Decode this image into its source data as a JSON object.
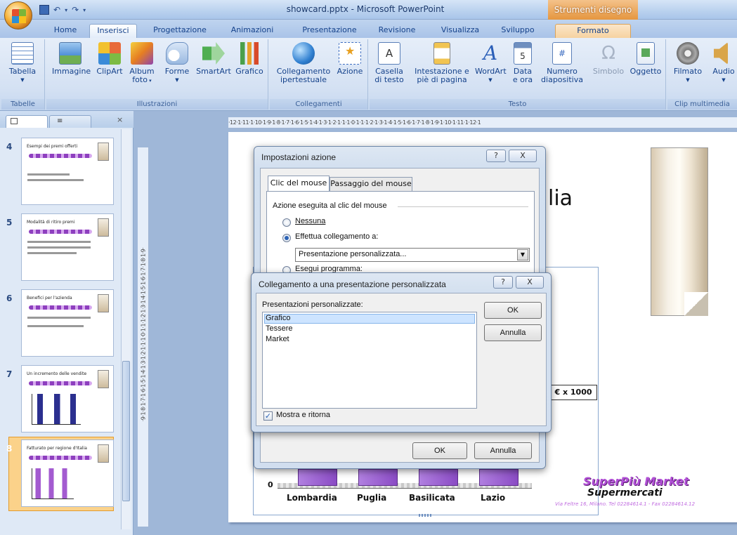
{
  "window": {
    "title": "showcard.pptx - Microsoft PowerPoint",
    "contextual_title": "Strumenti disegno"
  },
  "tabs": [
    "Home",
    "Inserisci",
    "Progettazione",
    "Animazioni",
    "Presentazione",
    "Revisione",
    "Visualizza",
    "Sviluppo",
    "Formato"
  ],
  "active_tab": "Inserisci",
  "ribbon": {
    "groups": {
      "tabelle": "Tabelle",
      "illustrazioni": "Illustrazioni",
      "collegamenti": "Collegamenti",
      "testo": "Testo",
      "clip": "Clip multimedia"
    },
    "buttons": {
      "tabella": "Tabella",
      "immagine": "Immagine",
      "clipart": "ClipArt",
      "album1": "Album",
      "album2": "foto",
      "forme": "Forme",
      "smartart": "SmartArt",
      "grafico": "Grafico",
      "collegamento1": "Collegamento",
      "collegamento2": "ipertestuale",
      "azione": "Azione",
      "casella1": "Casella",
      "casella2": "di testo",
      "intestazione1": "Intestazione e",
      "intestazione2": "piè di pagina",
      "wordart": "WordArt",
      "data1": "Data",
      "data2": "e ora",
      "numero1": "Numero",
      "numero2": "diapositiva",
      "simbolo": "Simbolo",
      "oggetto": "Oggetto",
      "filmato": "Filmato",
      "audio": "Audio"
    }
  },
  "slides": [
    {
      "num": "4",
      "title": "Esempi dei premi offerti"
    },
    {
      "num": "5",
      "title": "Modalità di ritiro premi"
    },
    {
      "num": "6",
      "title": "Benefici per l'azienda"
    },
    {
      "num": "7",
      "title": "Un incremento delle vendite"
    },
    {
      "num": "8",
      "title": "Fatturato per regione d'Italia",
      "selected": true
    }
  ],
  "ruler": {
    "horizontal": "·12·1·11·1·10·1·9·1·8·1·7·1·6·1·5·1·4·1·3·1·2·1·1·1·0·1·1·1·2·1·3·1·4·1·5·1·6·1·7·1·8·1·9·1·10·1·11·1·12·1",
    "vertical": "·9·1·8·1·7·1·6·1·5·1·4·1·3·1·2·1·1·1·0·1·1·1·2·1·3·1·4·1·5·1·6·1·7·1·8·1·9·"
  },
  "slide": {
    "title_fragment": "lia",
    "unit_label": "€ x 1000",
    "zero_label": "0",
    "categories": [
      "Lombardia",
      "Puglia",
      "Basilicata",
      "Lazio"
    ],
    "brand_line1": "SuperPiù Market",
    "brand_line2": "Supermercati",
    "address": "Via Feltre 16, Milano. Tel 02284614.1  - Fax 02284614.12"
  },
  "dialog_action": {
    "title": "Impostazioni azione",
    "help": "?",
    "close": "X",
    "tab_click": "Clic del mouse",
    "tab_hover": "Passaggio del mouse",
    "section": "Azione eseguita al clic del mouse",
    "opt_none": "Nessuna",
    "opt_link": "Effettua collegamento a:",
    "link_value": "Presentazione personalizzata...",
    "opt_program": "Esegui programma:",
    "ok": "OK",
    "cancel": "Annulla"
  },
  "dialog_custom": {
    "title": "Collegamento a una presentazione personalizzata",
    "help": "?",
    "close": "X",
    "list_label": "Presentazioni personalizzate:",
    "items": [
      "Grafico",
      "Tessere",
      "Market"
    ],
    "selected": "Grafico",
    "checkbox_label": "Mostra e ritorna",
    "checkbox_checked": true,
    "ok": "OK",
    "cancel": "Annulla"
  }
}
